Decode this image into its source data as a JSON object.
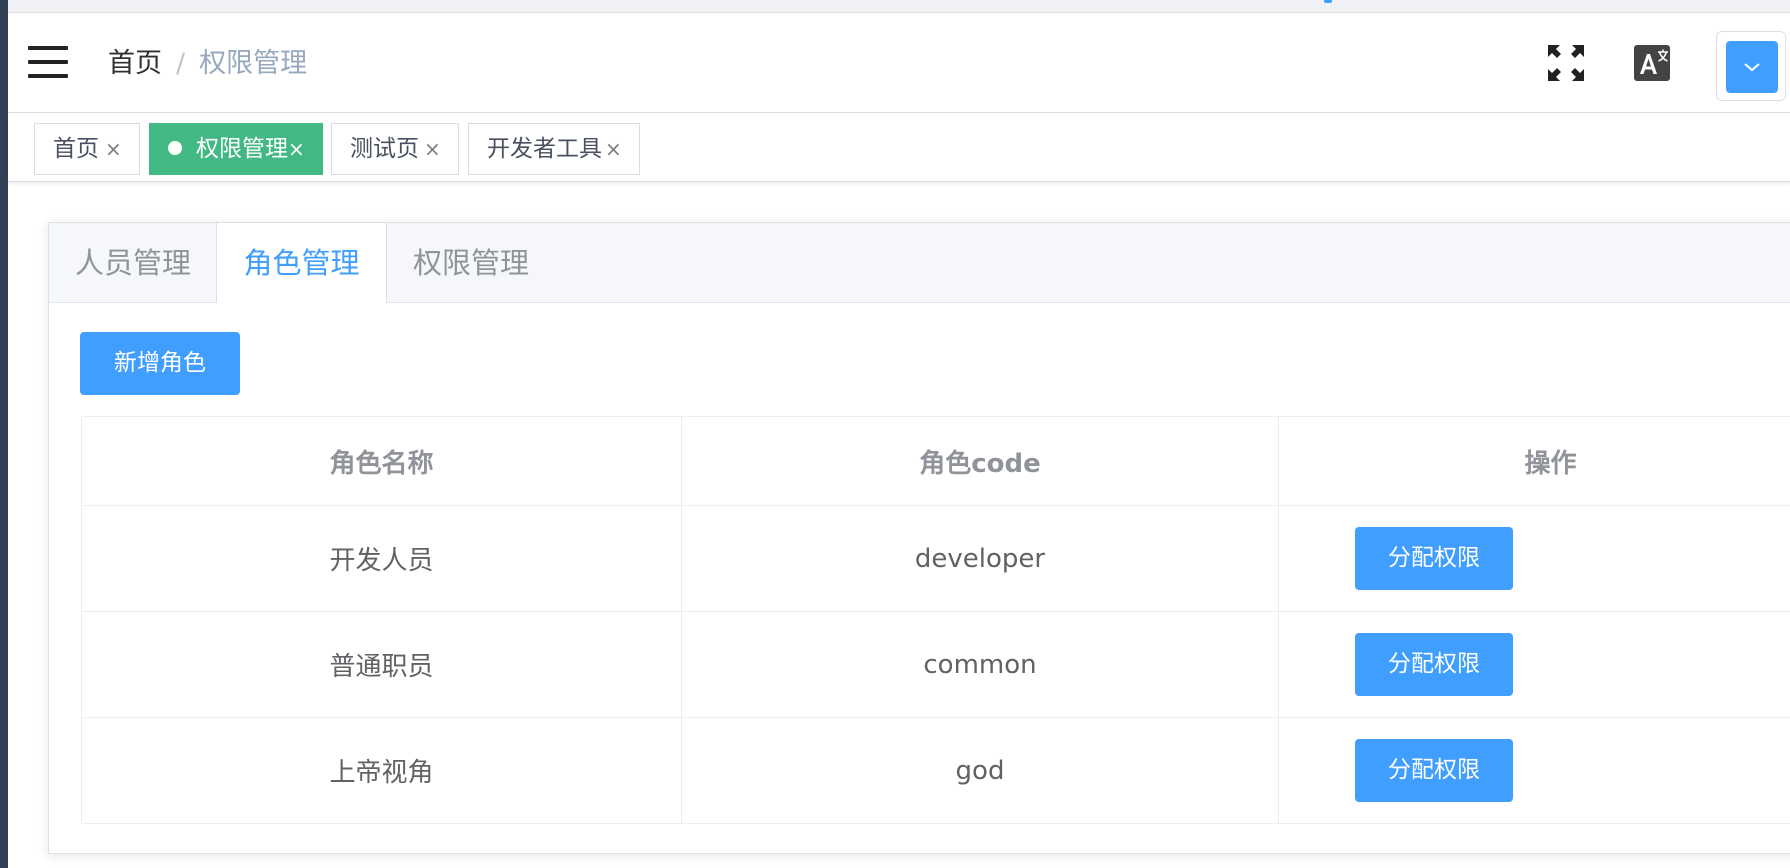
{
  "breadcrumb": {
    "home": "首页",
    "separator": "/",
    "current": "权限管理"
  },
  "tags": [
    {
      "label": "首页",
      "active": false
    },
    {
      "label": "权限管理",
      "active": true
    },
    {
      "label": "测试页",
      "active": false
    },
    {
      "label": "开发者工具",
      "active": false
    }
  ],
  "tag_close_glyph": "×",
  "navbar_icons": {
    "menu": "hamburger-icon",
    "fullscreen": "fullscreen-icon",
    "language": "translate-icon",
    "user_menu": "chevron-down-icon"
  },
  "tabs": [
    {
      "label": "人员管理",
      "active": false
    },
    {
      "label": "角色管理",
      "active": true
    },
    {
      "label": "权限管理",
      "active": false
    }
  ],
  "toolbar": {
    "add_role_label": "新增角色"
  },
  "table": {
    "headers": [
      "角色名称",
      "角色code",
      "操作"
    ],
    "rows": [
      {
        "name": "开发人员",
        "code": "developer",
        "action": "分配权限"
      },
      {
        "name": "普通职员",
        "code": "common",
        "action": "分配权限"
      },
      {
        "name": "上帝视角",
        "code": "god",
        "action": "分配权限"
      }
    ]
  },
  "colors": {
    "primary": "#409eff",
    "tag_active": "#42b983",
    "sidebar": "#304156"
  }
}
